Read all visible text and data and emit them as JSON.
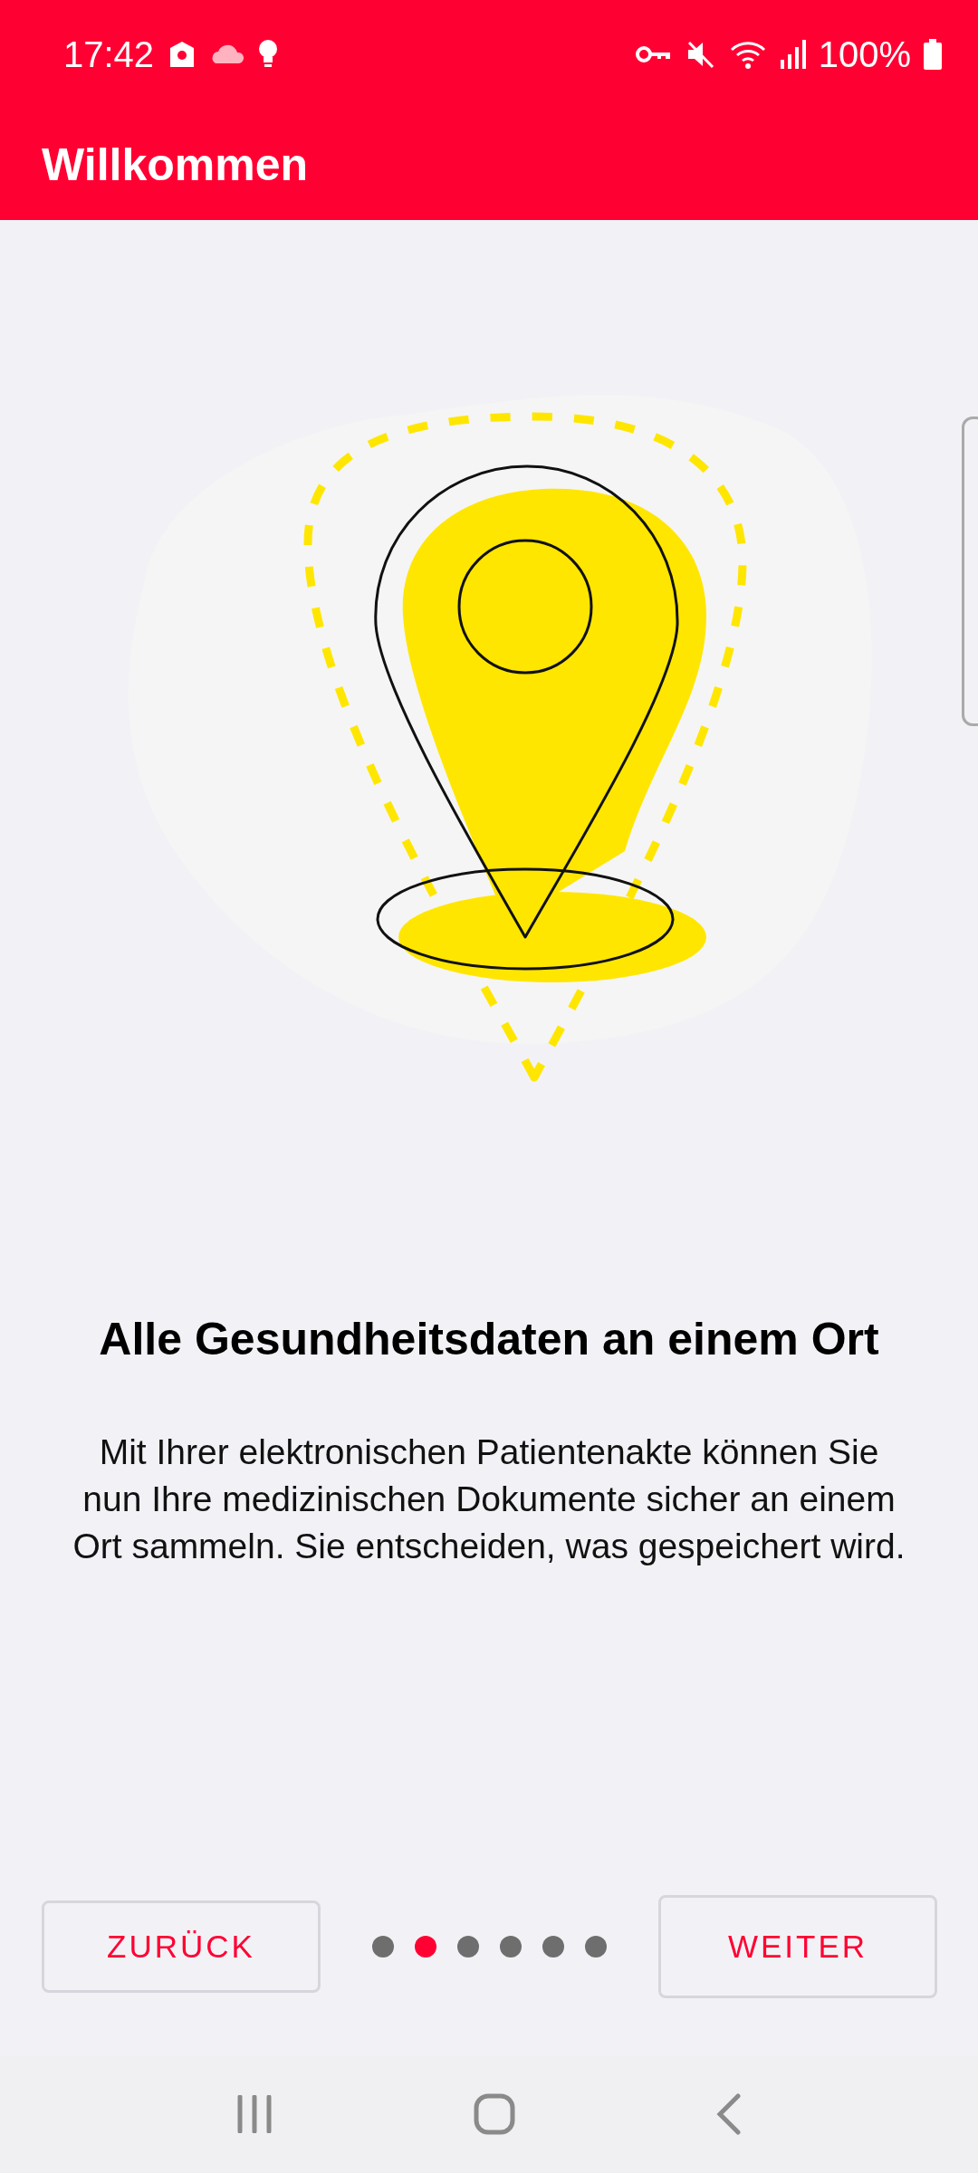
{
  "status_bar": {
    "time": "17:42",
    "battery": "100%"
  },
  "app_bar": {
    "title": "Willkommen"
  },
  "page": {
    "heading": "Alle Gesundheitsdaten an einem Ort",
    "body": "Mit Ihrer elektronischen Patientenakte können Sie nun Ihre medizinischen Dokumente sicher an einem Ort sammeln. Sie entscheiden, was gespeichert wird."
  },
  "pager": [
    {
      "selected": false
    },
    {
      "selected": true
    },
    {
      "selected": false
    },
    {
      "selected": false
    },
    {
      "selected": false
    },
    {
      "selected": false
    }
  ],
  "buttons": {
    "back": "ZURÜCK",
    "next": "WEITER"
  }
}
